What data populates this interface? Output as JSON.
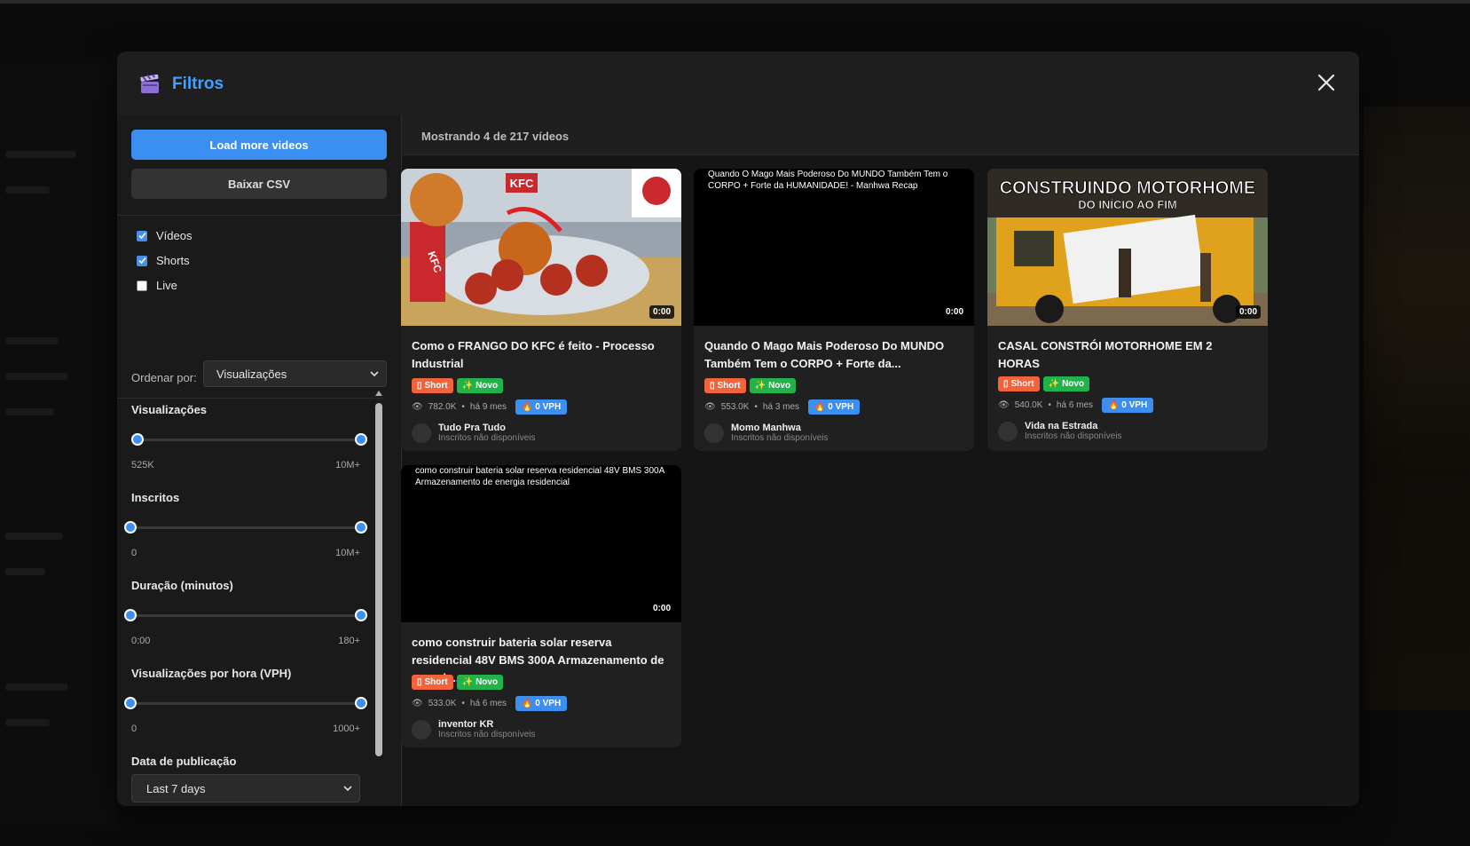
{
  "modal": {
    "title": "Filtros",
    "icons": {
      "title_icon": "clapper-board-icon",
      "close": "close-icon"
    }
  },
  "sidebar": {
    "load_more_label": "Load more videos",
    "csv_label": "Baixar CSV",
    "checkboxes": [
      {
        "label": "Vídeos",
        "checked": true
      },
      {
        "label": "Shorts",
        "checked": true
      },
      {
        "label": "Live",
        "checked": false
      }
    ],
    "order": {
      "label": "Ordenar por:",
      "value": "Visualizações"
    },
    "filters": [
      {
        "title": "Visualizações",
        "min": "525K",
        "max": "10M+"
      },
      {
        "title": "Inscritos",
        "min": "0",
        "max": "10M+"
      },
      {
        "title": "Duração (minutos)",
        "min": "0:00",
        "max": "180+"
      },
      {
        "title": "Visualizações por hora (VPH)",
        "min": "0",
        "max": "1000+"
      }
    ],
    "date": {
      "title": "Data de publicação",
      "value": "Last 7 days"
    }
  },
  "main": {
    "count_text": "Mostrando 4 de 217 vídeos",
    "videos": [
      {
        "title": "Como o FRANGO DO KFC é feito - Processo Industrial",
        "duration": "0:00",
        "badge_short": "Short",
        "badge_novo": "Novo",
        "views": "782.0K",
        "age": "há 9 mes",
        "vph": "0 VPH",
        "channel": "Tudo Pra Tudo",
        "subs": "Inscritos não disponíveis",
        "thumb_text": [
          "KFC",
          "KFC"
        ]
      },
      {
        "title": "Quando O Mago Mais Poderoso Do MUNDO Também Tem o CORPO + Forte da...",
        "duration": "0:00",
        "thumb_alt": "Quando O Mago Mais Poderoso Do MUNDO Também Tem o CORPO + Forte da HUMANIDADE! - Manhwa Recap",
        "badge_short": "Short",
        "badge_novo": "Novo",
        "views": "553.0K",
        "age": "há 3 mes",
        "vph": "0 VPH",
        "channel": "Momo Manhwa",
        "subs": "Inscritos não disponíveis"
      },
      {
        "title": "CASAL CONSTRÓI MOTORHOME EM 2 HORAS",
        "duration": "0:00",
        "thumb_text": [
          "CONSTRUINDO MOTORHOME",
          "DO INÍCIO AO FIM"
        ],
        "badge_short": "Short",
        "badge_novo": "Novo",
        "views": "540.0K",
        "age": "há 6 mes",
        "vph": "0 VPH",
        "channel": "Vida na Estrada",
        "subs": "Inscritos não disponíveis"
      },
      {
        "title": "como construir bateria solar reserva residencial 48V BMS 300A Armazenamento de energia...",
        "duration": "0:00",
        "thumb_alt": "como construir bateria solar reserva residencial 48V BMS 300A Armazenamento de energia residencial",
        "badge_short": "Short",
        "badge_novo": "Novo",
        "views": "533.0K",
        "age": "há 6 mes",
        "vph": "0 VPH",
        "channel": "inventor KR",
        "subs": "Inscritos não disponíveis"
      }
    ]
  },
  "colors": {
    "accent": "#3b8ff0",
    "title": "#3fa2ff",
    "short": "#f2633c",
    "novo": "#22b24c"
  }
}
